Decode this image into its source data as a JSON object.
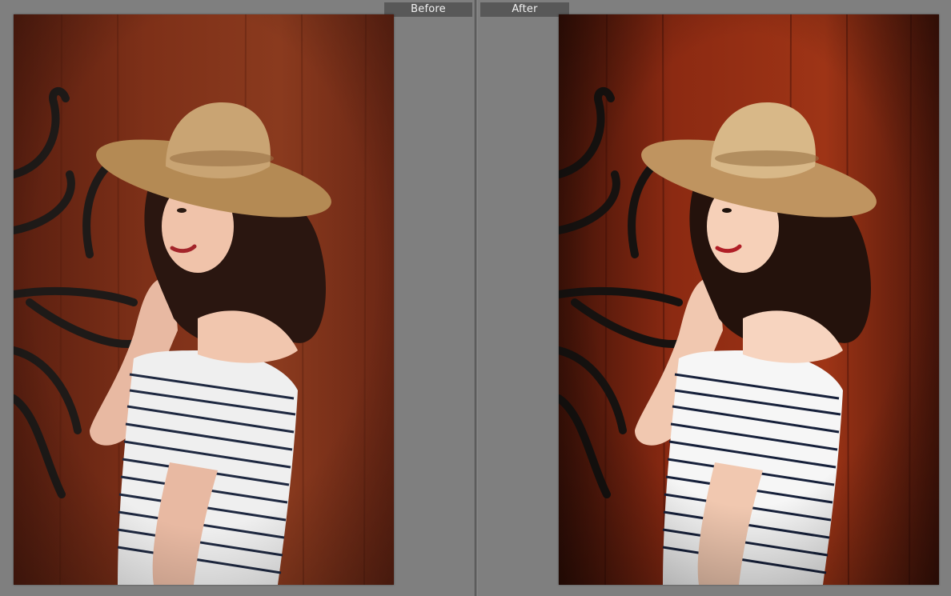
{
  "comparison": {
    "before_label": "Before",
    "after_label": "After"
  },
  "colors": {
    "background": "#7f7f7f",
    "label_bg": "#585858",
    "label_text": "#f2f2f2",
    "before_wood": "#7a2d18",
    "after_wood": "#8a2410"
  }
}
